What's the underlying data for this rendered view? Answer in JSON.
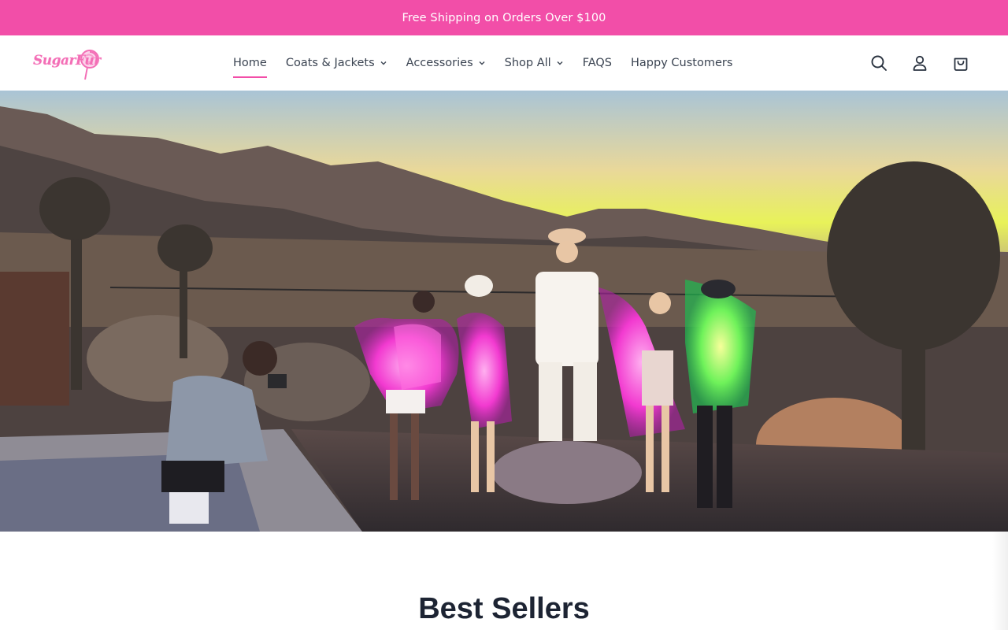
{
  "announcement": {
    "text": "Free Shipping on Orders Over $100"
  },
  "brand": {
    "logo_text": "SugarFur",
    "accent_color": "#f24ea8"
  },
  "nav": {
    "items": [
      {
        "label": "Home",
        "active": true,
        "has_dropdown": false
      },
      {
        "label": "Coats & Jackets",
        "active": false,
        "has_dropdown": true
      },
      {
        "label": "Accessories",
        "active": false,
        "has_dropdown": true
      },
      {
        "label": "Shop All",
        "active": false,
        "has_dropdown": true
      },
      {
        "label": "FAQS",
        "active": false,
        "has_dropdown": false
      },
      {
        "label": "Happy Customers",
        "active": false,
        "has_dropdown": false
      }
    ]
  },
  "header_icons": [
    "search-icon",
    "account-icon",
    "cart-icon"
  ],
  "hero": {
    "image_alt": "Group in glowing LED fur coats posing in the desert at sunset"
  },
  "sections": {
    "best_sellers_title": "Best Sellers"
  }
}
